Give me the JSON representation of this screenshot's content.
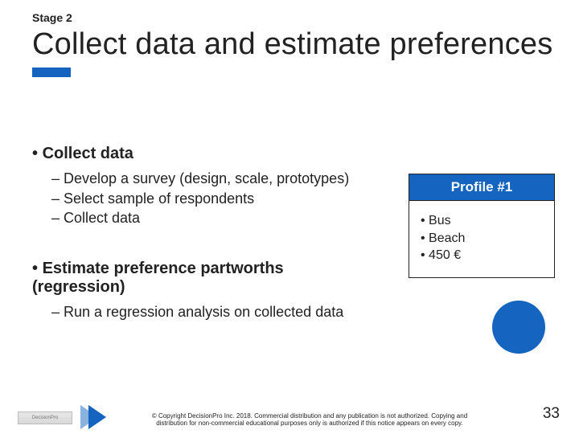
{
  "stage_label": "Stage 2",
  "title": "Collect data and estimate preferences",
  "section1": {
    "heading": "Collect data",
    "subs": [
      "Develop a survey (design, scale, prototypes)",
      "Select sample of respondents",
      "Collect data"
    ]
  },
  "section2": {
    "heading": "Estimate preference partworths (regression)",
    "subs": [
      "Run a regression analysis on collected data"
    ]
  },
  "profile": {
    "title": "Profile #1",
    "items": [
      "Bus",
      "Beach",
      "450 €"
    ]
  },
  "footer": {
    "logo_text": "DecisionPro",
    "copyright": "© Copyright DecisionPro Inc. 2018. Commercial distribution and any publication is not authorized. Copying and distribution for non-commercial educational purposes only is authorized if this notice appears on every copy.",
    "page": "33"
  }
}
